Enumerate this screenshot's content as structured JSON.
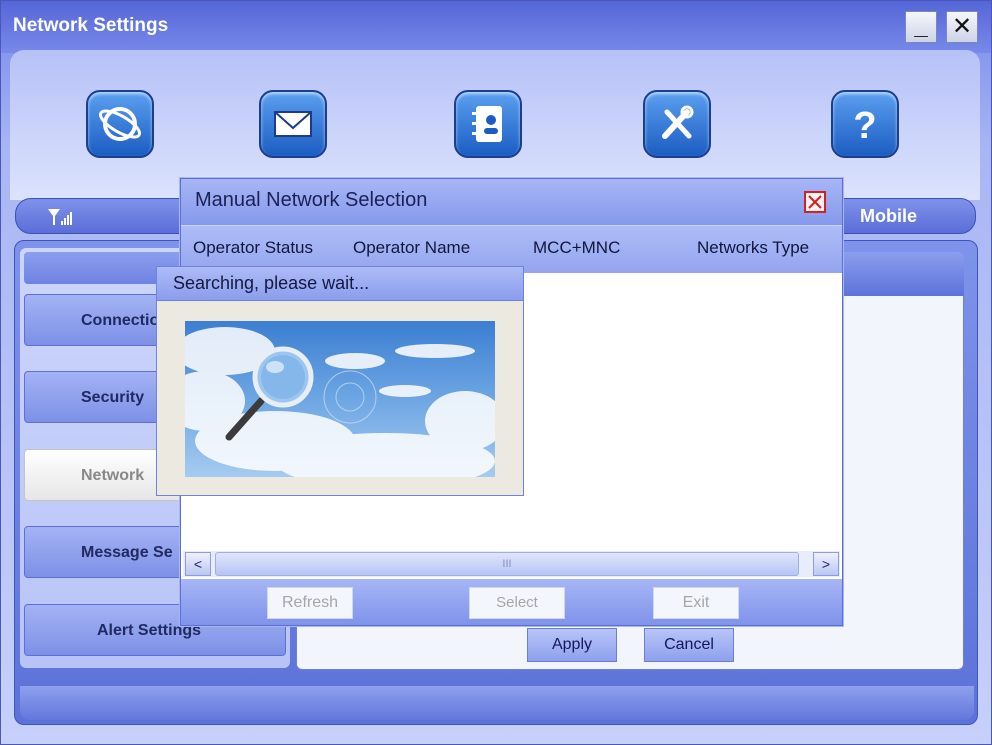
{
  "window": {
    "title": "Network Settings",
    "minimize": "_",
    "close": "✕"
  },
  "toolbar": {
    "icons": [
      "internet-icon",
      "message-icon",
      "contacts-icon",
      "settings-icon",
      "help-icon"
    ],
    "help_glyph": "?"
  },
  "statusbar": {
    "carrier": "Mobile"
  },
  "sidebar": {
    "items": [
      {
        "label": "Connectio",
        "active": false
      },
      {
        "label": "Security",
        "active": false
      },
      {
        "label": "Network",
        "active": true
      },
      {
        "label": "Message Se",
        "active": false
      },
      {
        "label": "Alert Settings",
        "active": false
      }
    ]
  },
  "content": {
    "apply": "Apply",
    "cancel": "Cancel"
  },
  "dialog": {
    "title": "Manual Network Selection",
    "columns": [
      "Operator Status",
      "Operator Name",
      "MCC+MNC",
      "Networks Type"
    ],
    "scroll_left": "<",
    "scroll_right": ">",
    "scroll_grip": "III",
    "buttons": {
      "refresh": "Refresh",
      "select": "Select",
      "exit": "Exit"
    }
  },
  "search": {
    "text": "Searching, please wait..."
  },
  "colors": {
    "accent": "#6f80e4",
    "close_red": "#d42020"
  }
}
